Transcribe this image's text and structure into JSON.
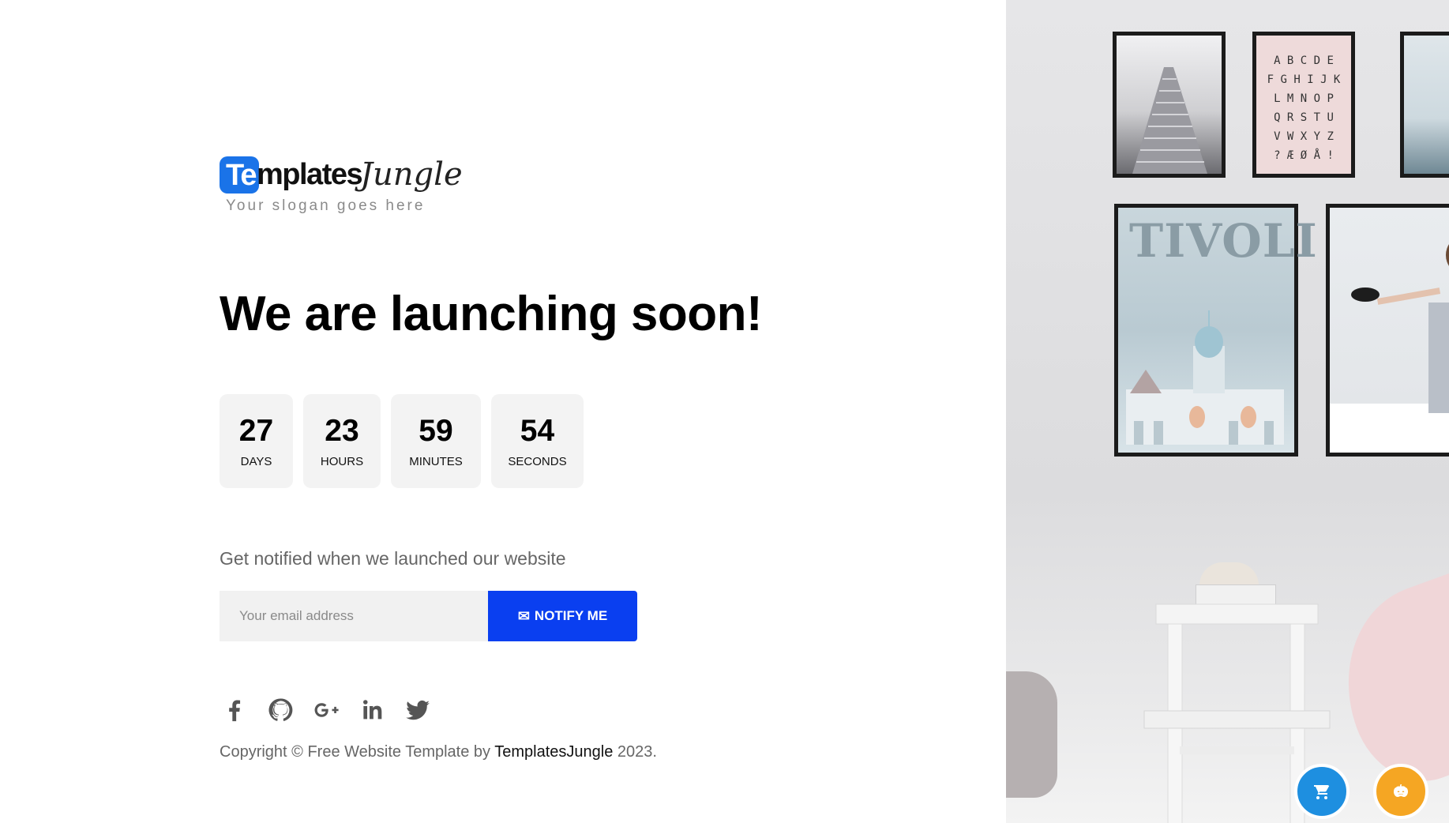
{
  "logo": {
    "mark": "Te",
    "text": "mplates",
    "script": "Jungle",
    "slogan": "Your slogan goes here"
  },
  "headline": "We are launching soon!",
  "countdown": [
    {
      "value": "27",
      "label": "DAYS"
    },
    {
      "value": "23",
      "label": "HOURS"
    },
    {
      "value": "59",
      "label": "MINUTES"
    },
    {
      "value": "54",
      "label": "SECONDS"
    }
  ],
  "notify": {
    "text": "Get notified when we launched our website",
    "placeholder": "Your email address",
    "button_label": "NOTIFY ME",
    "button_icon": "envelope-icon"
  },
  "social_icons": [
    "facebook-icon",
    "github-icon",
    "google-plus-icon",
    "linkedin-icon",
    "twitter-icon"
  ],
  "footer": {
    "prefix": "Copyright © Free Website Template by ",
    "brand": "TemplatesJungle",
    "suffix": " 2023."
  },
  "poster": {
    "alphabet": [
      "A B C D E",
      "F G H I J K",
      "L M N O P",
      "Q R S T U",
      "V W X Y Z",
      "? Æ Ø Å !"
    ],
    "tivoli": "TIVOLI"
  },
  "floating_buttons": [
    "cart-icon",
    "pumpkin-icon"
  ],
  "colors": {
    "accent": "#0a3ff0",
    "logo_blue": "#1a73e8",
    "fab_blue": "#1e8fe0",
    "fab_orange": "#f5a623"
  }
}
